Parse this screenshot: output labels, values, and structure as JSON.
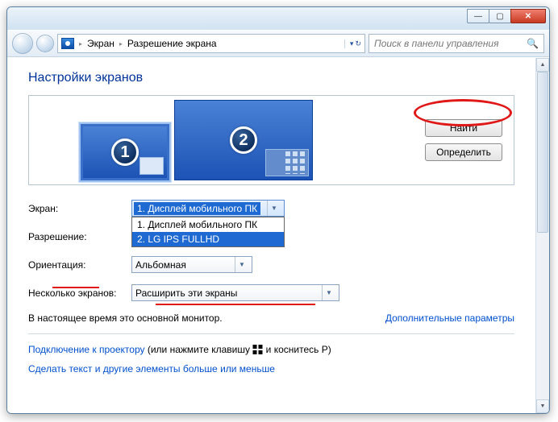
{
  "titlebar": {
    "min": "—",
    "max": "▢",
    "close": "✕"
  },
  "address": {
    "seg1": "Экран",
    "seg2": "Разрешение экрана",
    "arrow": "▸"
  },
  "search": {
    "placeholder": "Поиск в панели управления"
  },
  "page": {
    "title": "Настройки экранов",
    "monitor1": "1",
    "monitor2": "2",
    "find_btn": "Найти",
    "detect_btn": "Определить"
  },
  "labels": {
    "display": "Экран:",
    "resolution": "Разрешение:",
    "orientation": "Ориентация:",
    "multi": "Несколько экранов:"
  },
  "selects": {
    "display": "1. Дисплей мобильного ПК",
    "orientation": "Альбомная",
    "multi": "Расширить эти экраны"
  },
  "dropdown": {
    "opt1": "1. Дисплей мобильного ПК",
    "opt2": "2. LG IPS FULLHD"
  },
  "notes": {
    "primary": "В настоящее время это основной монитор.",
    "advanced": "Дополнительные параметры",
    "projector_link": "Подключение к проектору",
    "projector_rest_a": " (или нажмите клавишу ",
    "projector_rest_b": " и коснитесь P)",
    "textsize": "Сделать текст и другие элементы больше или меньше"
  }
}
